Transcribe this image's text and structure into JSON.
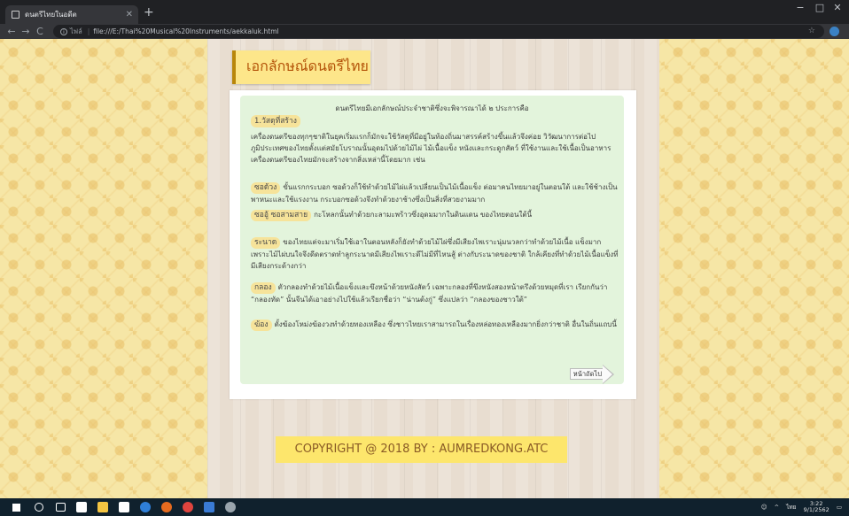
{
  "browser": {
    "tab_title": "ดนตรีไทยในอดีต",
    "new_tab_symbol": "+",
    "nav": {
      "back": "←",
      "forward": "→",
      "reload": "C"
    },
    "address": {
      "security_label": "ไฟล์",
      "url": "file:///E:/Thai%20Musical%20Instruments/aekkaluk.html"
    },
    "window_controls": [
      "−",
      "□",
      "✕"
    ]
  },
  "page": {
    "title": "เอกลักษณ์ดนตรีไทย",
    "intro": "ดนตรีไทยมีเอกลักษณ์ประจำชาติซึ่งจะพิจารณาได้ ๒ ประการคือ",
    "section_heading": "1.วัสดุที่สร้าง",
    "section_paragraph": "เครื่องดนตรีของทุกๆชาติในยุคเริ่มแรกก็มักจะใช้วัสดุที่มีอยู่ในท้องถิ่นมาสรรค์สร้างขึ้นแล้วจึงค่อย วิวัฒนาการต่อไป ภูมิประเทศของไทยตั้งแต่สมัยโบราณนั้นอุดมไปด้วยไม้ไผ่ ไม้เนื้อแข็ง หนังและกระดูกสัตว์ ที่ใช้งานและใช้เนื้อเป็นอาหาร เครื่องดนตรีของไทยมักจะสร้างจากสิ่งเหล่านี้โดยมาก เช่น",
    "items": [
      {
        "label": "ซอด้วง",
        "text": "ขั้นแรกกระบอก ซอด้วงก็ใช้ทำด้วยไม้ไผ่แล้วเปลี่ยนเป็นไม้เนื้อแข็ง ต่อมาคนไทยมาอยู่ในตอนใต้ และใช้ช้างเป็นพาหนะและใช้แรงงาน กระบอกซอด้วงจึงทำด้วยงาช้างซึ่งเป็นสิ่งที่สวยงามมาก"
      },
      {
        "label": "ซออู้ ซอสามสาย",
        "text": "กะโหลกนั้นทำด้วยกะลามะพร้าวซึ่งอุดมมากในดินแดน ของไทยตอนใต้นี้"
      },
      {
        "label": "ระนาด",
        "text": "ของไทยแต่จะมาเริ่มใช้เอาในตอนหลังก็ยังทำด้วยไม้ไผ่ซึ่งมีเสียงไพเราะนุ่มนวลกว่าทำด้วยไม้เนื้อ แข็งมาก เพราะไม้ไผ่บนใจจึงดีดตราดทำลูกระนาดมีเสียงไพเราะดีไม่มีที่ไหนสู้ ต่างกับระนาดของชาติ ใกล้เคียงที่ทำด้วยไม้เนื้อแข็งที่มีเสียงกระด้างกว่า"
      },
      {
        "label": "กลอง",
        "text": "ตัวกลองทำด้วยไม้เนื้อแข็งและขึงหน้าด้วยหนังสัตว์ เฉพาะกลองที่ขึงหนังสองหน้าตรึงด้วยหมุดที่เรา เรียกกันว่า “กลองทัด” นั้นจีนได้เอาอย่างไปใช้แล้วเรียกชื่อว่า “น่านต้งกู่” ซึ่งแปลว่า “กลองของชาวใต้”"
      },
      {
        "label": "ฆ้อง",
        "text": "ตั้งฆ้องโหม่งฆ้องวงทำด้วยทองเหลือง ซึ่งชาวไทยเราสามารถในเรื่องหล่อทองเหลืองมากยิ่งกว่าชาติ อื่นในถิ่นแถบนี้"
      }
    ],
    "next_button": "หน้าถัดไป",
    "copyright": "COPYRIGHT @ 2018 BY : AUMREDKONG.ATC"
  },
  "taskbar": {
    "lang": "ไทย",
    "time": "3:22",
    "date": "9/1/2562"
  },
  "colors": {
    "title_bg": "#fde68a",
    "title_text": "#b45309",
    "highlight": "#f6e39a",
    "card_green": "#e3f4dc",
    "copyright_bg": "#fde66c",
    "copyright_text": "#8a5b26"
  }
}
